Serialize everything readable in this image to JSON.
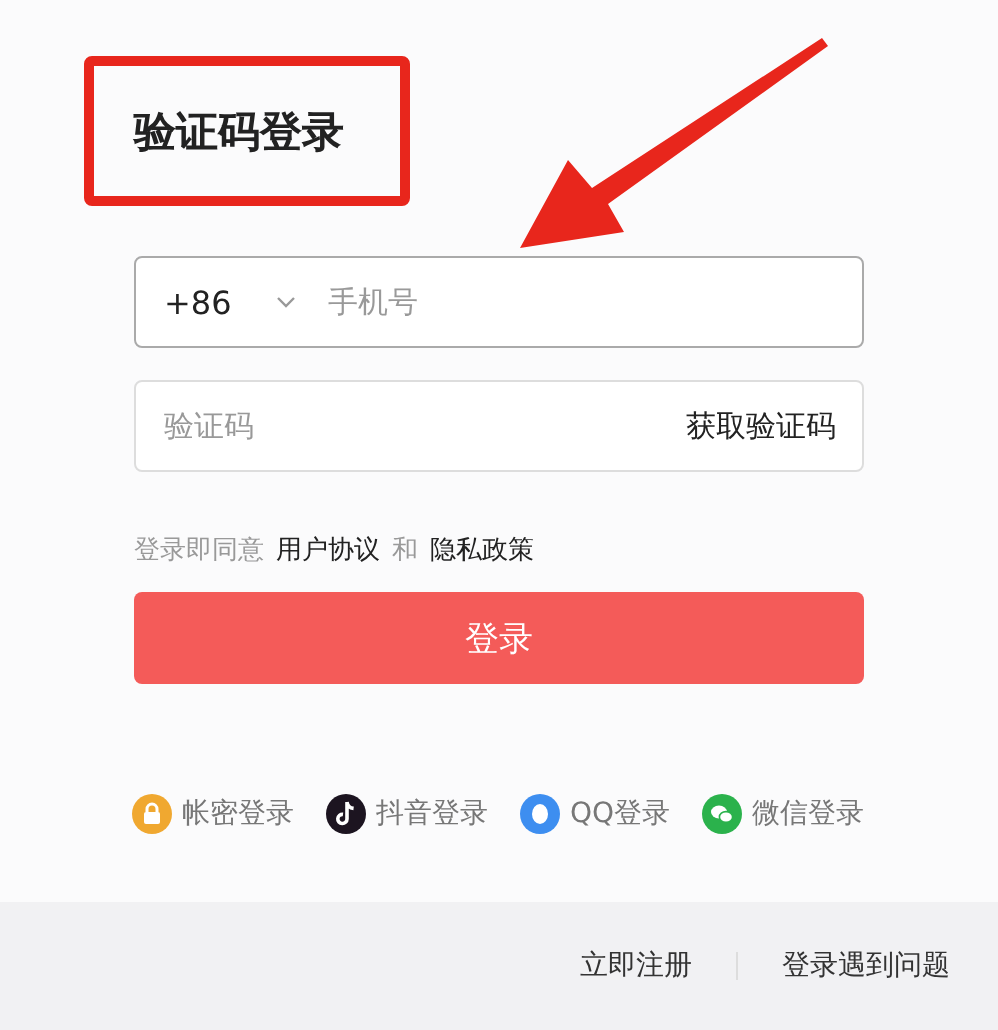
{
  "title": {
    "text": "验证码登录",
    "highlighted": true
  },
  "annotations": [
    {
      "kind": "arrow"
    }
  ],
  "phone_field": {
    "country_code": "+86",
    "placeholder": "手机号"
  },
  "code_field": {
    "placeholder": "验证码",
    "action": "获取验证码"
  },
  "agreement": {
    "prefix": "登录即同意",
    "link_1": "用户协议",
    "joiner": "和",
    "link_2": "隐私政策"
  },
  "login_button": "登录",
  "login_methods": [
    {
      "kind": "lock",
      "label": "帐密登录",
      "color": "#f0a830"
    },
    {
      "kind": "tiktok",
      "label": "抖音登录",
      "color": "#1c1420"
    },
    {
      "kind": "qq",
      "label": "QQ登录",
      "color": "#3d8ef0"
    },
    {
      "kind": "wechat",
      "label": "微信登录",
      "color": "#2bb24c"
    }
  ],
  "footer": {
    "register": "立即注册",
    "help": "登录遇到问题"
  }
}
